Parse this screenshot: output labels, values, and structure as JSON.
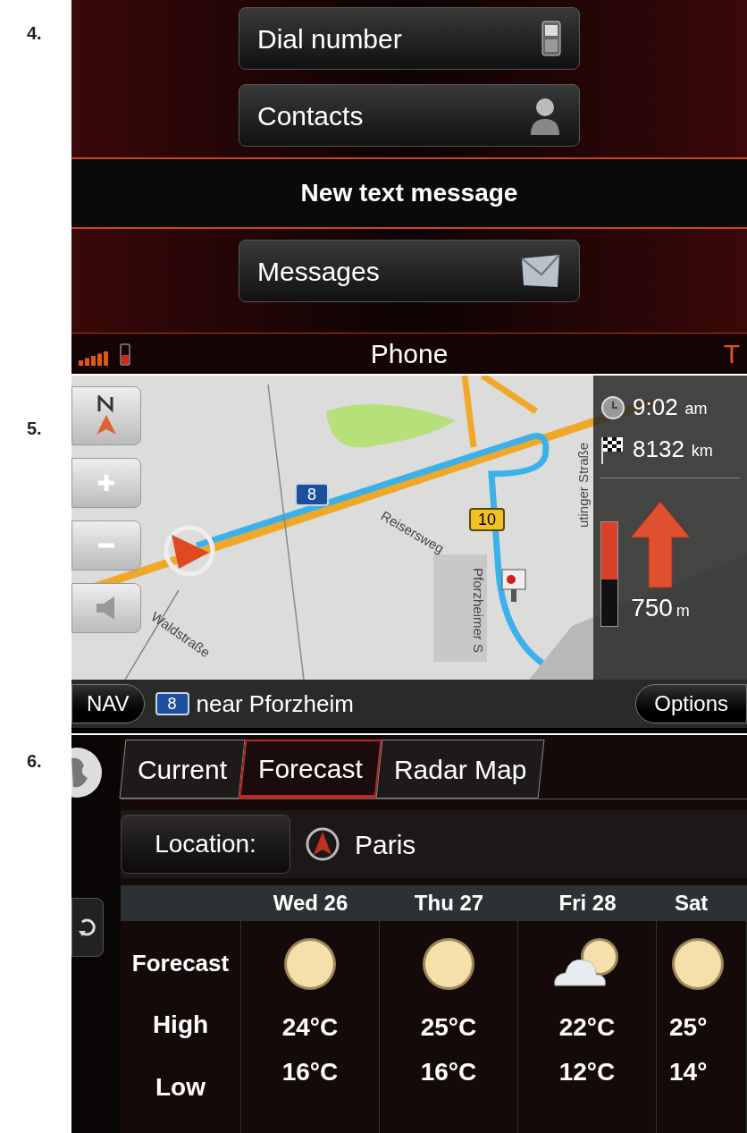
{
  "phone": {
    "step": "4.",
    "menu": [
      {
        "kind": "button",
        "label": "Dial number"
      },
      {
        "kind": "button",
        "label": "Contacts"
      },
      {
        "kind": "header",
        "label": "New text message"
      },
      {
        "kind": "button",
        "label": "Messages"
      }
    ],
    "status_bar": {
      "title": "Phone",
      "right_text": "T"
    }
  },
  "navigation": {
    "step": "5.",
    "map_labels": [
      "Reisersweg",
      "Pforzheimer S",
      "Waldstraße",
      "utinger Straße"
    ],
    "road_shields": [
      {
        "label": "8",
        "kind": "motorway"
      },
      {
        "label": "10",
        "kind": "federal"
      }
    ],
    "time": "9:02",
    "time_unit": "am",
    "distance": "8132",
    "distance_unit": "km",
    "turn_bar": {
      "level": 0.55
    },
    "next_turn": "750",
    "next_turn_unit": "m",
    "nav_button": "NAV",
    "road": "8",
    "road_text": "near Pforzheim",
    "options_button": "Options"
  },
  "weather": {
    "step": "6.",
    "tabs": [
      {
        "label": "Current",
        "selected": false
      },
      {
        "label": "Forecast",
        "selected": true
      },
      {
        "label": "Radar Map",
        "selected": false
      }
    ],
    "location_button": "Location:",
    "location": "Paris",
    "row_labels": [
      "Forecast",
      "High",
      "Low"
    ],
    "days": [
      {
        "day": "Wed 26",
        "kind": "sunny",
        "high": "24°C",
        "low": "16°C"
      },
      {
        "day": "Thu 27",
        "kind": "sunny",
        "high": "25°C",
        "low": "16°C"
      },
      {
        "day": "Fri 28",
        "kind": "cloudy",
        "high": "22°C",
        "low": "12°C"
      },
      {
        "day": "Sat",
        "kind": "sunny",
        "high": "25°",
        "low": "14°"
      }
    ]
  }
}
